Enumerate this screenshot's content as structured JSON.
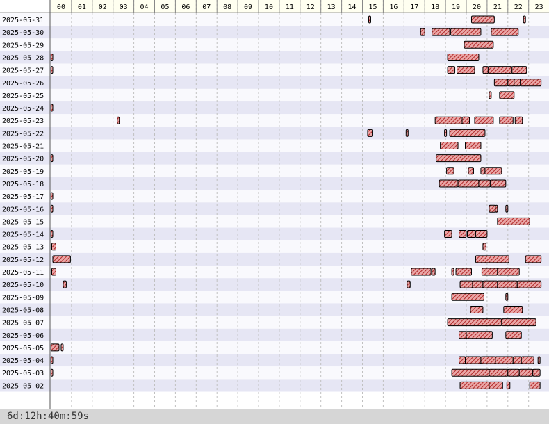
{
  "chart_data": {
    "type": "timeline",
    "hours": [
      "00",
      "01",
      "02",
      "03",
      "04",
      "05",
      "06",
      "07",
      "08",
      "09",
      "10",
      "11",
      "12",
      "13",
      "14",
      "15",
      "16",
      "17",
      "18",
      "19",
      "20",
      "21",
      "22",
      "23"
    ],
    "rows": [
      {
        "date": "2025-05-31",
        "segments": [
          [
            15.3,
            15.4
          ],
          [
            20.25,
            21.35
          ],
          [
            22.75,
            22.85
          ]
        ]
      },
      {
        "date": "2025-05-30",
        "segments": [
          [
            17.8,
            18.0
          ],
          [
            18.35,
            19.2
          ],
          [
            19.25,
            20.7
          ],
          [
            21.2,
            22.5
          ]
        ]
      },
      {
        "date": "2025-05-29",
        "segments": [
          [
            19.9,
            21.3
          ]
        ]
      },
      {
        "date": "2025-05-28",
        "segments": [
          [
            -0.05,
            0.05
          ],
          [
            19.1,
            20.6
          ]
        ]
      },
      {
        "date": "2025-05-27",
        "segments": [
          [
            -0.05,
            0.05
          ],
          [
            19.1,
            19.45
          ],
          [
            19.55,
            20.4
          ],
          [
            20.8,
            21.05
          ],
          [
            21.05,
            22.2
          ],
          [
            22.2,
            22.9
          ]
        ]
      },
      {
        "date": "2025-05-26",
        "segments": [
          [
            21.35,
            22.0
          ],
          [
            22.0,
            22.3
          ],
          [
            22.3,
            22.6
          ],
          [
            22.6,
            23.6
          ]
        ]
      },
      {
        "date": "2025-05-25",
        "segments": [
          [
            21.1,
            21.2
          ],
          [
            21.6,
            22.3
          ]
        ]
      },
      {
        "date": "2025-05-24",
        "segments": [
          [
            -0.05,
            0.05
          ]
        ]
      },
      {
        "date": "2025-05-23",
        "segments": [
          [
            3.2,
            3.3
          ],
          [
            18.5,
            19.8
          ],
          [
            19.8,
            20.15
          ],
          [
            20.4,
            21.3
          ],
          [
            21.6,
            22.25
          ],
          [
            22.35,
            22.7
          ]
        ]
      },
      {
        "date": "2025-05-22",
        "segments": [
          [
            15.25,
            15.5
          ],
          [
            17.1,
            17.2
          ],
          [
            18.95,
            19.05
          ],
          [
            19.2,
            20.9
          ]
        ]
      },
      {
        "date": "2025-05-21",
        "segments": [
          [
            18.75,
            19.6
          ],
          [
            19.95,
            20.7
          ]
        ]
      },
      {
        "date": "2025-05-20",
        "segments": [
          [
            -0.05,
            0.05
          ],
          [
            18.55,
            20.7
          ]
        ]
      },
      {
        "date": "2025-05-19",
        "segments": [
          [
            19.05,
            19.4
          ],
          [
            20.1,
            20.35
          ],
          [
            20.7,
            20.9
          ],
          [
            20.9,
            21.7
          ]
        ]
      },
      {
        "date": "2025-05-18",
        "segments": [
          [
            18.7,
            19.6
          ],
          [
            19.6,
            20.6
          ],
          [
            20.6,
            21.15
          ],
          [
            21.15,
            21.9
          ]
        ]
      },
      {
        "date": "2025-05-17",
        "segments": [
          [
            -0.05,
            0.05
          ]
        ]
      },
      {
        "date": "2025-05-16",
        "segments": [
          [
            -0.05,
            0.05
          ],
          [
            21.1,
            21.4
          ],
          [
            21.4,
            21.5
          ],
          [
            21.9,
            22.0
          ]
        ]
      },
      {
        "date": "2025-05-15",
        "segments": [
          [
            21.5,
            23.05
          ]
        ]
      },
      {
        "date": "2025-05-14",
        "segments": [
          [
            -0.05,
            0.05
          ],
          [
            18.95,
            19.3
          ],
          [
            19.65,
            20.0
          ],
          [
            20.05,
            20.45
          ],
          [
            20.45,
            21.0
          ]
        ]
      },
      {
        "date": "2025-05-13",
        "segments": [
          [
            0.05,
            0.25
          ],
          [
            20.8,
            20.95
          ]
        ]
      },
      {
        "date": "2025-05-12",
        "segments": [
          [
            0.1,
            0.95
          ],
          [
            20.45,
            22.05
          ],
          [
            22.85,
            23.6
          ]
        ]
      },
      {
        "date": "2025-05-11",
        "segments": [
          [
            0.05,
            0.25
          ],
          [
            17.35,
            18.3
          ],
          [
            18.35,
            18.5
          ],
          [
            19.3,
            19.4
          ],
          [
            19.5,
            20.25
          ],
          [
            20.75,
            21.5
          ],
          [
            21.5,
            22.55
          ]
        ]
      },
      {
        "date": "2025-05-10",
        "segments": [
          [
            0.6,
            0.75
          ],
          [
            17.15,
            17.3
          ],
          [
            19.7,
            20.3
          ],
          [
            20.3,
            20.8
          ],
          [
            20.8,
            21.5
          ],
          [
            21.5,
            22.45
          ],
          [
            22.45,
            23.6
          ]
        ]
      },
      {
        "date": "2025-05-09",
        "segments": [
          [
            19.3,
            20.85
          ],
          [
            21.9,
            22.0
          ]
        ]
      },
      {
        "date": "2025-05-08",
        "segments": [
          [
            20.2,
            20.8
          ],
          [
            21.8,
            22.7
          ]
        ]
      },
      {
        "date": "2025-05-07",
        "segments": [
          [
            19.1,
            21.7
          ],
          [
            21.7,
            23.35
          ]
        ]
      },
      {
        "date": "2025-05-06",
        "segments": [
          [
            19.65,
            20.0
          ],
          [
            20.0,
            21.25
          ],
          [
            21.9,
            22.65
          ]
        ]
      },
      {
        "date": "2025-05-05",
        "segments": [
          [
            -0.05,
            0.4
          ],
          [
            0.5,
            0.6
          ]
        ]
      },
      {
        "date": "2025-05-04",
        "segments": [
          [
            -0.05,
            0.05
          ],
          [
            19.65,
            19.95
          ],
          [
            19.95,
            20.7
          ],
          [
            20.7,
            21.4
          ],
          [
            21.4,
            22.25
          ],
          [
            22.25,
            22.65
          ],
          [
            22.65,
            23.25
          ],
          [
            23.45,
            23.55
          ]
        ]
      },
      {
        "date": "2025-05-03",
        "segments": [
          [
            -0.05,
            0.05
          ],
          [
            19.3,
            21.1
          ],
          [
            21.1,
            22.0
          ],
          [
            22.0,
            22.55
          ],
          [
            22.55,
            23.2
          ],
          [
            23.2,
            23.55
          ]
        ]
      },
      {
        "date": "2025-05-02",
        "segments": [
          [
            19.7,
            21.1
          ],
          [
            21.1,
            21.75
          ],
          [
            21.95,
            22.1
          ],
          [
            23.05,
            23.55
          ]
        ]
      }
    ]
  },
  "status": {
    "total": "6d:12h:40m:59s"
  },
  "colors": {
    "bar_fill": "#e8a0a0",
    "bar_hatch": "#b03030",
    "bar_border": "#000000",
    "row_alt": "#e6e6f4",
    "row": "#f9f9fd",
    "header_bg": "#fffff0",
    "grid": "#c0c0c0"
  }
}
